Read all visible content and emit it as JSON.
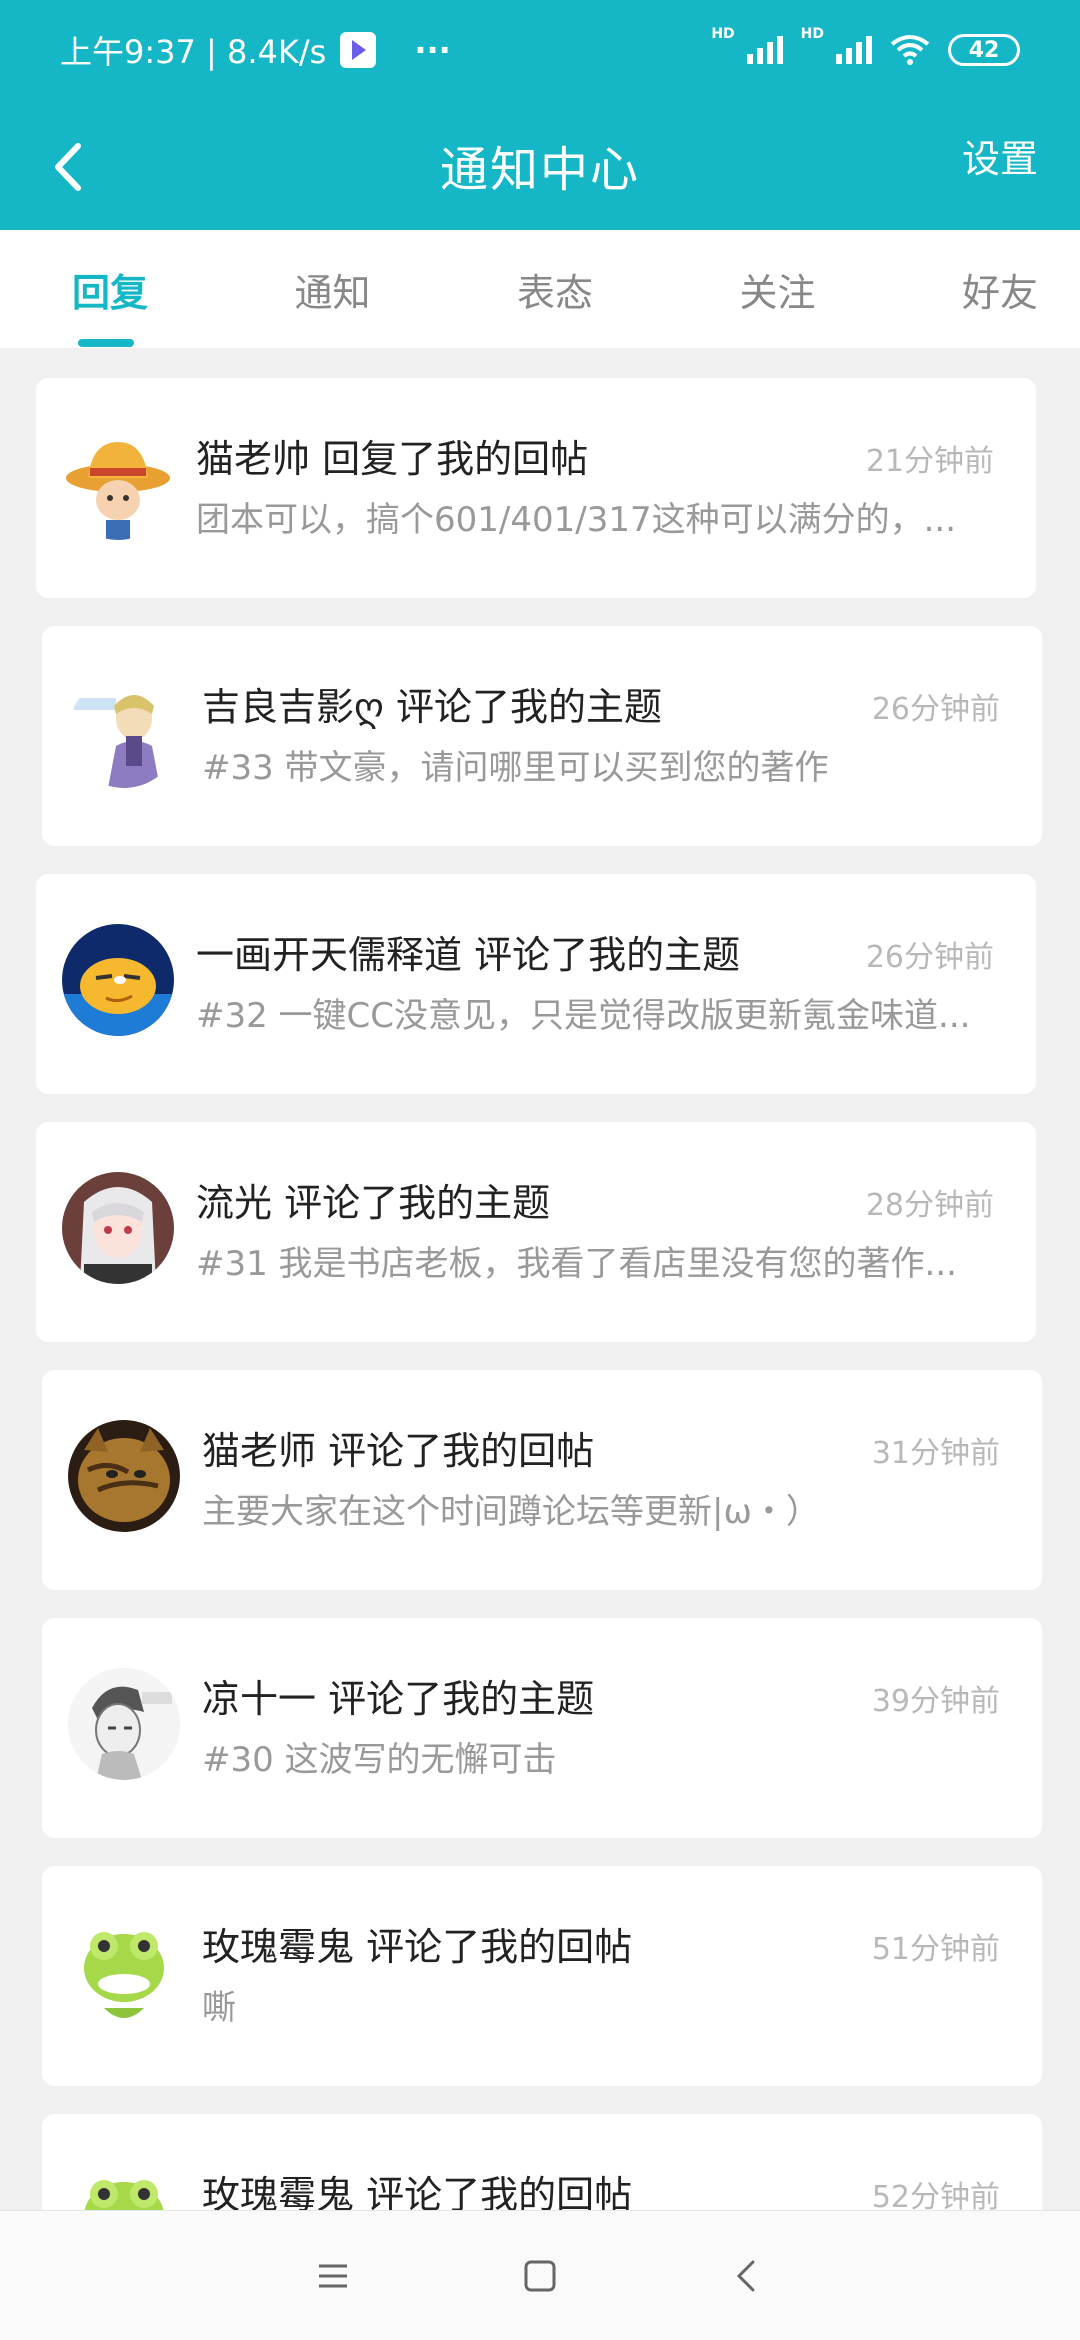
{
  "status": {
    "time_speed": "上午9:37 | 8.4K/s",
    "dots": "···",
    "hd1": "HD",
    "hd2": "HD",
    "battery": "42"
  },
  "header": {
    "title": "通知中心",
    "settings_label": "设置",
    "accent": "#15b7c6"
  },
  "tabs": [
    {
      "label": "回复"
    },
    {
      "label": "通知"
    },
    {
      "label": "表态"
    },
    {
      "label": "关注"
    },
    {
      "label": "好友"
    }
  ],
  "notifications": [
    {
      "title": "猫老帅 回复了我的回帖",
      "time": "21分钟前",
      "preview": "团本可以，搞个601/401/317这种可以满分的，...",
      "avatar": "straw-hat-avatar"
    },
    {
      "title": "吉良吉影ღ 评论了我的主题",
      "time": "26分钟前",
      "preview": "#33 带文豪，请问哪里可以买到您的著作",
      "avatar": "anime-man-avatar"
    },
    {
      "title": "一画开天儒释道 评论了我的主题",
      "time": "26分钟前",
      "preview": "#32 一键CC没意见，只是觉得改版更新氪金味道...",
      "avatar": "smug-face-avatar"
    },
    {
      "title": "流光 评论了我的主题",
      "time": "28分钟前",
      "preview": "#31 我是书店老板，我看了看店里没有您的著作...",
      "avatar": "anime-girl-avatar"
    },
    {
      "title": "猫老师 评论了我的回帖",
      "time": "31分钟前",
      "preview": "主要大家在这个时间蹲论坛等更新|ω・）",
      "avatar": "cat-avatar"
    },
    {
      "title": "凉十一 评论了我的主题",
      "time": "39分钟前",
      "preview": "#30 这波写的无懈可击",
      "avatar": "sketch-avatar"
    },
    {
      "title": "玫瑰霉鬼 评论了我的回帖",
      "time": "51分钟前",
      "preview": "嘶",
      "avatar": "frog-avatar"
    },
    {
      "title": "玫瑰霉鬼 评论了我的回帖",
      "time": "52分钟前",
      "preview": "",
      "avatar": "frog-avatar"
    }
  ]
}
